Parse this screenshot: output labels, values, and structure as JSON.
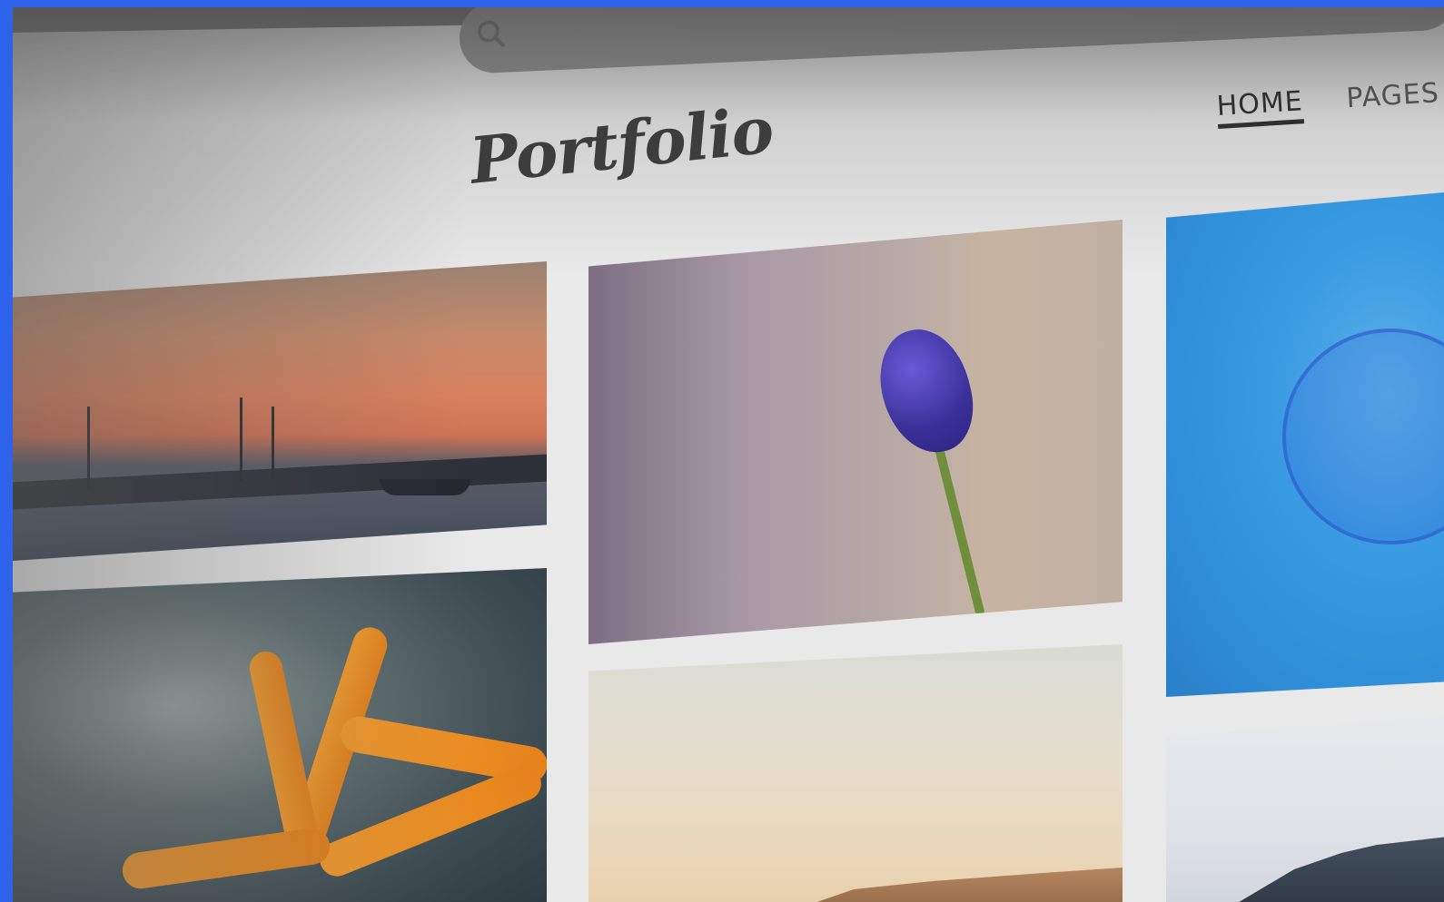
{
  "site": {
    "logo_text": "Portfolio"
  },
  "search": {
    "placeholder": ""
  },
  "nav": {
    "items": [
      {
        "label": "HOME",
        "active": true
      },
      {
        "label": "PAGES",
        "active": false
      }
    ]
  },
  "gallery": {
    "tiles": [
      {
        "subject": "sunset-harbor"
      },
      {
        "subject": "grape-hyacinth"
      },
      {
        "subject": "jellyfish"
      },
      {
        "subject": "starfish"
      },
      {
        "subject": "coastal-town"
      },
      {
        "subject": "snowy-mountain"
      }
    ]
  },
  "colors": {
    "frame": "#2d63ea",
    "header_bar": "#6a6a6a",
    "page_bg": "#e9e9e9",
    "text_dark": "#2f2f2f"
  }
}
